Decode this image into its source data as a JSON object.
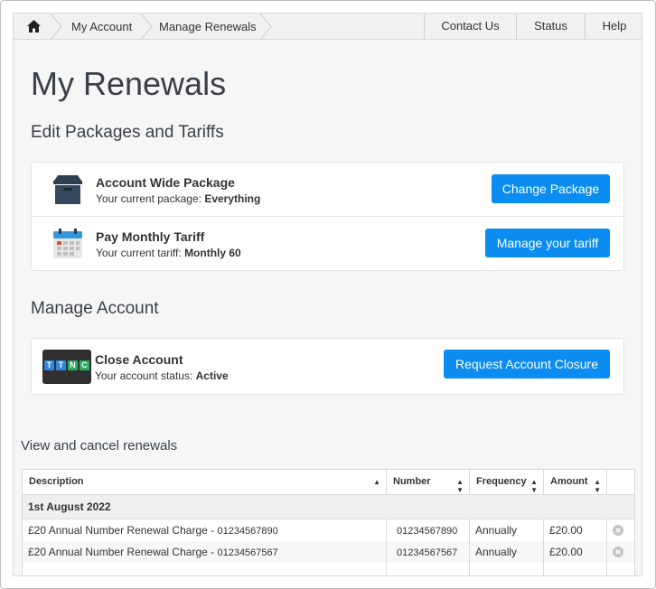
{
  "breadcrumb": {
    "home_icon": "home-icon",
    "items": [
      "My Account",
      "Manage Renewals"
    ]
  },
  "nav": {
    "links": [
      "Contact Us",
      "Status",
      "Help"
    ]
  },
  "page_title": "My Renewals",
  "packages_section": {
    "heading": "Edit Packages and Tariffs",
    "rows": [
      {
        "icon": "archive-box-icon",
        "title": "Account Wide Package",
        "sub_label": "Your current package:",
        "sub_value": "Everything",
        "button": "Change Package"
      },
      {
        "icon": "calendar-icon",
        "title": "Pay Monthly Tariff",
        "sub_label": "Your current tariff:",
        "sub_value": "Monthly 60",
        "button": "Manage your tariff"
      }
    ]
  },
  "account_section": {
    "heading": "Manage Account",
    "logo_letters": [
      "T",
      "T",
      "N",
      "C"
    ],
    "title": "Close Account",
    "sub_label": "Your account status:",
    "sub_value": "Active",
    "button": "Request Account Closure"
  },
  "renewals": {
    "heading": "View and cancel renewals",
    "columns": [
      "Description",
      "Number",
      "Frequency",
      "Amount"
    ],
    "group_label": "1st August 2022",
    "rows": [
      {
        "description": "£20 Annual Number Renewal Charge - ",
        "desc_number": "01234567890",
        "number": "01234567890",
        "frequency": "Annually",
        "amount": "£20.00"
      },
      {
        "description": "£20 Annual Number Renewal Charge - ",
        "desc_number": "01234567567",
        "number": "01234567567",
        "frequency": "Annually",
        "amount": "£20.00"
      }
    ]
  },
  "colors": {
    "accent": "#0a8cf0",
    "heading": "#3a3f47"
  }
}
